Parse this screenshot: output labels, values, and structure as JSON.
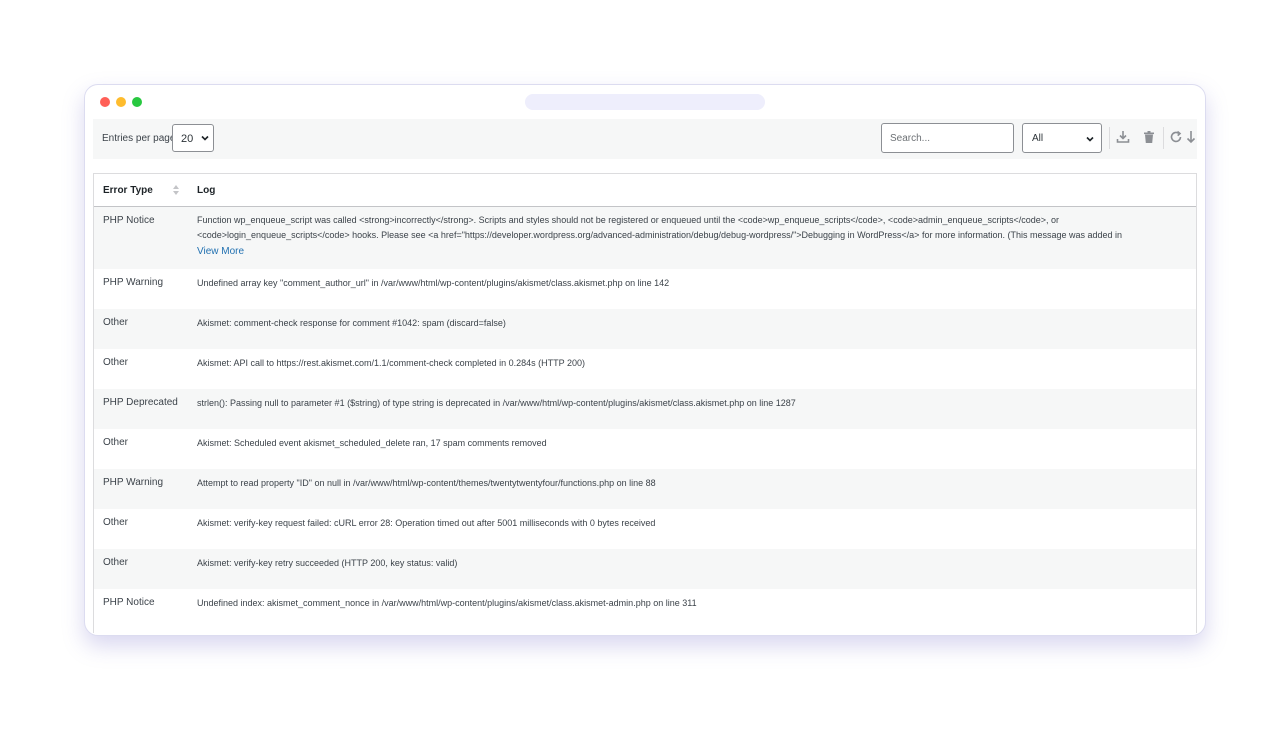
{
  "toolbar": {
    "entries_label": "Entries per page:",
    "entries_value": "20",
    "search_placeholder": "Search...",
    "type_filter_value": "All",
    "icons": [
      "download-icon",
      "trash-icon",
      "refresh-icon",
      "sort-down-icon"
    ]
  },
  "table": {
    "headers": {
      "type": "Error Type",
      "log": "Log"
    },
    "rows": [
      {
        "type": "PHP Notice",
        "log": "Function wp_enqueue_script was called <strong>incorrectly</strong>. Scripts and styles should not be registered or enqueued until the <code>wp_enqueue_scripts</code>, <code>admin_enqueue_scripts</code>, or <code>login_enqueue_scripts</code> hooks. Please see <a href=\"https://developer.wordpress.org/advanced-administration/debug/debug-wordpress/\">Debugging in WordPress</a> for more information. (This message was added in",
        "view_more": "View More"
      },
      {
        "type": "PHP Warning",
        "log": "Undefined array key \"comment_author_url\" in /var/www/html/wp-content/plugins/akismet/class.akismet.php on line 142"
      },
      {
        "type": "Other",
        "log": "Akismet: comment-check response for comment #1042: spam (discard=false)"
      },
      {
        "type": "Other",
        "log": "Akismet: API call to https://rest.akismet.com/1.1/comment-check completed in 0.284s (HTTP 200)"
      },
      {
        "type": "PHP Deprecated",
        "log": "strlen(): Passing null to parameter #1 ($string) of type string is deprecated in /var/www/html/wp-content/plugins/akismet/class.akismet.php on line 1287"
      },
      {
        "type": "Other",
        "log": "Akismet: Scheduled event akismet_scheduled_delete ran, 17 spam comments removed"
      },
      {
        "type": "PHP Warning",
        "log": "Attempt to read property \"ID\" on null in /var/www/html/wp-content/themes/twentytwentyfour/functions.php on line 88"
      },
      {
        "type": "Other",
        "log": "Akismet: verify-key request failed: cURL error 28: Operation timed out after 5001 milliseconds with 0 bytes received"
      },
      {
        "type": "Other",
        "log": "Akismet: verify-key retry succeeded (HTTP 200, key status: valid)"
      },
      {
        "type": "PHP Notice",
        "log": "Undefined index: akismet_comment_nonce in /var/www/html/wp-content/plugins/akismet/class.akismet-admin.php on line 311"
      }
    ]
  },
  "colors": {
    "link": "#2271b1",
    "stripe": "#f6f7f7",
    "window_shadow": "#c8c0f0"
  }
}
